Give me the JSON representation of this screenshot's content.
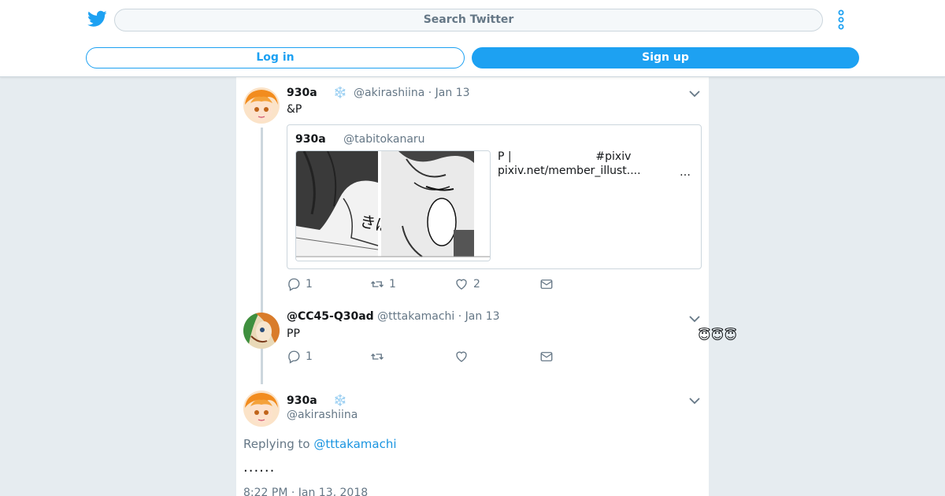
{
  "header": {
    "logo": "twitter-bird-icon",
    "search_placeholder": "Search Twitter",
    "more_icon": "vertical-dots-icon",
    "login_label": "Log in",
    "signup_label": "Sign up"
  },
  "colors": {
    "accent": "#1da1f2",
    "background": "#e6ecf0",
    "muted": "#657786"
  },
  "tweets": [
    {
      "name": "930a",
      "name_emoji": "❄️",
      "handle": "@akirashiina",
      "date": "· Jan 13",
      "text": "&P",
      "quote": {
        "name": "930a",
        "handle": "@tabitokanaru",
        "line1": "P |                        #pixiv",
        "line2": "pixiv.net/member_illust....",
        "ellipsis": "…"
      },
      "replies": "1",
      "retweets": "1",
      "likes": "2"
    },
    {
      "name": "@CC45-Q30ad",
      "handle": "@tttakamachi",
      "date": "· Jan 13",
      "text": "PP",
      "replies": "1",
      "retweets": "",
      "likes": ""
    },
    {
      "name": "930a",
      "name_emoji": "❄️",
      "handle": "@akirashiina",
      "replying_prefix": "Replying to",
      "replying_to": "@tttakamachi",
      "text": "......",
      "timestamp": "8:22 PM · Jan 13, 2018"
    }
  ],
  "side_emojis": "😇😇😇"
}
